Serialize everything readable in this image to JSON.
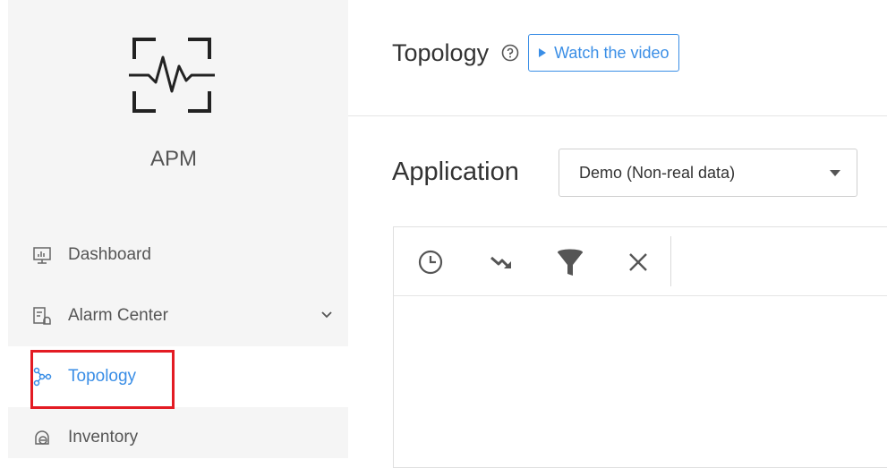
{
  "sidebar": {
    "app_name": "APM",
    "items": [
      {
        "label": "Dashboard",
        "icon": "dashboard-icon"
      },
      {
        "label": "Alarm Center",
        "icon": "alarm-center-icon",
        "expandable": true
      },
      {
        "label": "Topology",
        "icon": "topology-icon",
        "active": true
      },
      {
        "label": "Inventory",
        "icon": "inventory-icon"
      }
    ]
  },
  "header": {
    "title": "Topology",
    "video_button": "Watch the video"
  },
  "filter": {
    "label": "Application",
    "selected": "Demo (Non-real data)"
  },
  "toolbar": {
    "tools": [
      "clock-icon",
      "trend-icon",
      "filter-icon",
      "close-icon"
    ]
  },
  "colors": {
    "accent": "#3a8ee6",
    "highlight": "#e31b23",
    "sidebar_bg": "#f5f5f5"
  }
}
